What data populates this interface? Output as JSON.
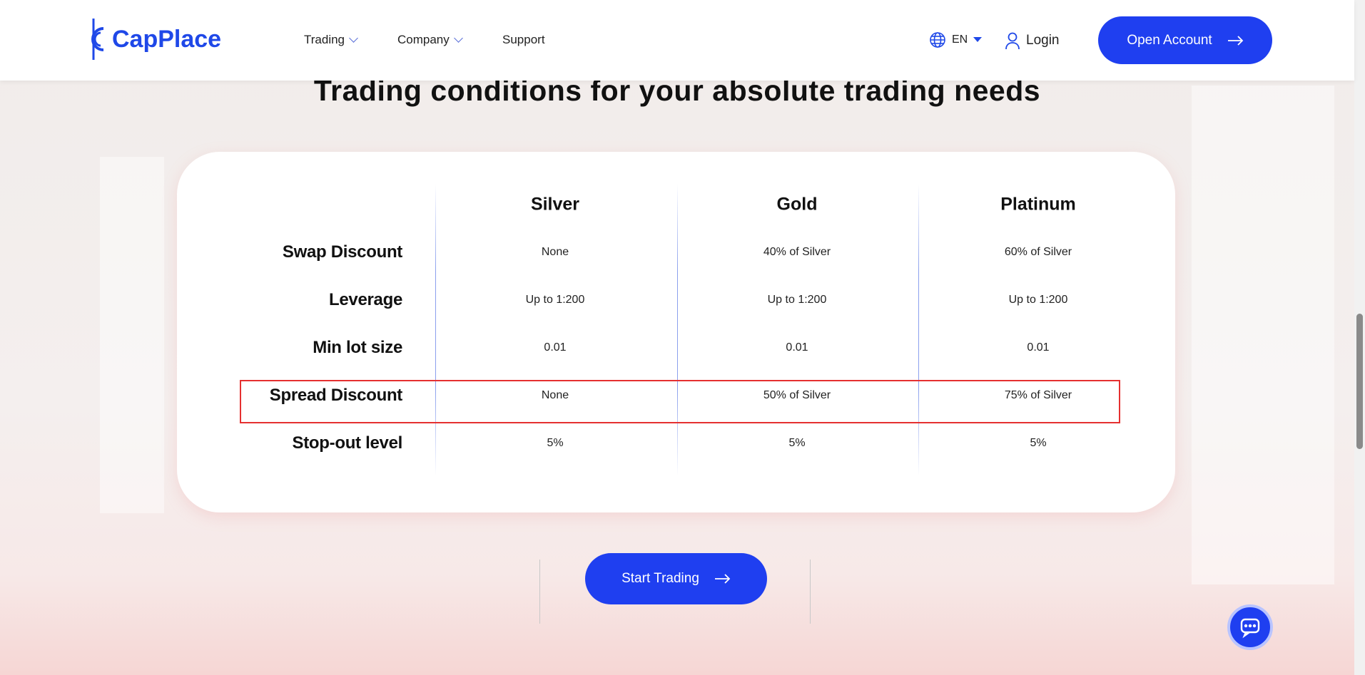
{
  "header": {
    "brand": "CapPlace",
    "nav": [
      {
        "label": "Trading",
        "has_dropdown": true
      },
      {
        "label": "Company",
        "has_dropdown": true
      },
      {
        "label": "Support",
        "has_dropdown": false
      }
    ],
    "language": "EN",
    "login": "Login",
    "open_account": "Open Account"
  },
  "title": "Trading conditions for your absolute trading needs",
  "table": {
    "columns": [
      "Silver",
      "Gold",
      "Platinum"
    ],
    "rows": [
      {
        "label": "Swap Discount",
        "values": [
          "None",
          "40% of Silver",
          "60% of Silver"
        ]
      },
      {
        "label": "Leverage",
        "values": [
          "Up to 1:200",
          "Up to 1:200",
          "Up to 1:200"
        ]
      },
      {
        "label": "Min lot size",
        "values": [
          "0.01",
          "0.01",
          "0.01"
        ]
      },
      {
        "label": "Spread Discount",
        "values": [
          "None",
          "50% of Silver",
          "75% of Silver"
        ],
        "highlighted": true
      },
      {
        "label": "Stop-out level",
        "values": [
          "5%",
          "5%",
          "5%"
        ]
      }
    ]
  },
  "cta": "Start Trading",
  "colors": {
    "accent": "#1f3ff0",
    "highlight": "#e53030"
  },
  "icons": {
    "logo": "capplace-logo-icon",
    "lang": "globe-icon",
    "user": "user-icon",
    "arrow": "arrow-right-icon",
    "chat": "chat-bubble-icon"
  }
}
